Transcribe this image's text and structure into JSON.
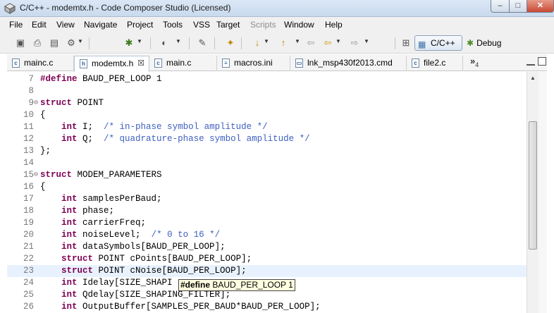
{
  "window": {
    "title": "C/C++ - modemtx.h - Code Composer Studio (Licensed)",
    "controls": {
      "minimize": "–",
      "maximize": "□",
      "close": "✕"
    }
  },
  "menu": [
    {
      "label": "File"
    },
    {
      "label": "Edit"
    },
    {
      "label": "View"
    },
    {
      "label": "Navigate"
    },
    {
      "label": "Project"
    },
    {
      "label": "Tools"
    },
    {
      "label": "VSS"
    },
    {
      "label": "Target"
    },
    {
      "label": "Scripts",
      "disabled": true
    },
    {
      "label": "Window"
    },
    {
      "label": "Help"
    }
  ],
  "toolbar": {
    "perspectives": [
      {
        "label": "C/C++",
        "icon": "c-cpp-perspective-icon",
        "active": true
      },
      {
        "label": "Debug",
        "icon": "debug-bug-icon",
        "active": false
      }
    ]
  },
  "tabs": [
    {
      "label": "mainc.c",
      "icon": "c"
    },
    {
      "label": "modemtx.h",
      "icon": "h",
      "active": true
    },
    {
      "label": "main.c",
      "icon": "c"
    },
    {
      "label": "macros.ini",
      "icon": "ini"
    },
    {
      "label": "lnk_msp430f2013.cmd",
      "icon": "cmd"
    },
    {
      "label": "file2.c",
      "icon": "c"
    }
  ],
  "tab_overflow": {
    "label": "»",
    "count": "4"
  },
  "editor": {
    "lines": [
      {
        "n": "7",
        "fold": "",
        "code": [
          [
            "pp",
            "#define"
          ],
          [
            "t",
            " BAUD_PER_LOOP 1"
          ]
        ]
      },
      {
        "n": "8",
        "fold": "",
        "code": []
      },
      {
        "n": "9",
        "fold": "⊖",
        "code": [
          [
            "kw",
            "struct"
          ],
          [
            "t",
            " POINT"
          ]
        ]
      },
      {
        "n": "10",
        "fold": "",
        "code": [
          [
            "t",
            "{"
          ]
        ]
      },
      {
        "n": "11",
        "fold": "",
        "code": [
          [
            "t",
            "    "
          ],
          [
            "kw",
            "int"
          ],
          [
            "t",
            " I;  "
          ],
          [
            "cm",
            "/* in-phase symbol amplitude */"
          ]
        ]
      },
      {
        "n": "12",
        "fold": "",
        "code": [
          [
            "t",
            "    "
          ],
          [
            "kw",
            "int"
          ],
          [
            "t",
            " Q;  "
          ],
          [
            "cm",
            "/* quadrature-phase symbol amplitude */"
          ]
        ]
      },
      {
        "n": "13",
        "fold": "",
        "code": [
          [
            "t",
            "};"
          ]
        ]
      },
      {
        "n": "14",
        "fold": "",
        "code": []
      },
      {
        "n": "15",
        "fold": "⊖",
        "code": [
          [
            "kw",
            "struct"
          ],
          [
            "t",
            " MODEM_PARAMETERS"
          ]
        ]
      },
      {
        "n": "16",
        "fold": "",
        "code": [
          [
            "t",
            "{"
          ]
        ]
      },
      {
        "n": "17",
        "fold": "",
        "code": [
          [
            "t",
            "    "
          ],
          [
            "kw",
            "int"
          ],
          [
            "t",
            " samplesPerBaud;"
          ]
        ]
      },
      {
        "n": "18",
        "fold": "",
        "code": [
          [
            "t",
            "    "
          ],
          [
            "kw",
            "int"
          ],
          [
            "t",
            " phase;"
          ]
        ]
      },
      {
        "n": "19",
        "fold": "",
        "code": [
          [
            "t",
            "    "
          ],
          [
            "kw",
            "int"
          ],
          [
            "t",
            " carrierFreq;"
          ]
        ]
      },
      {
        "n": "20",
        "fold": "",
        "code": [
          [
            "t",
            "    "
          ],
          [
            "kw",
            "int"
          ],
          [
            "t",
            " noiseLevel;  "
          ],
          [
            "cm",
            "/* 0 to 16 */"
          ]
        ]
      },
      {
        "n": "21",
        "fold": "",
        "code": [
          [
            "t",
            "    "
          ],
          [
            "kw",
            "int"
          ],
          [
            "t",
            " dataSymbols[BAUD_PER_LOOP];"
          ]
        ]
      },
      {
        "n": "22",
        "fold": "",
        "code": [
          [
            "t",
            "    "
          ],
          [
            "kw",
            "struct"
          ],
          [
            "t",
            " POINT cPoints[BAUD_PER_LOOP];"
          ]
        ]
      },
      {
        "n": "23",
        "fold": "",
        "current": true,
        "code": [
          [
            "t",
            "    "
          ],
          [
            "kw",
            "struct"
          ],
          [
            "t",
            " POINT cNoise[BAUD_PER_LOOP];"
          ]
        ]
      },
      {
        "n": "24",
        "fold": "",
        "code": [
          [
            "t",
            "    "
          ],
          [
            "kw",
            "int"
          ],
          [
            "t",
            " Idelay[SIZE_SHAPI"
          ]
        ]
      },
      {
        "n": "25",
        "fold": "",
        "code": [
          [
            "t",
            "    "
          ],
          [
            "kw",
            "int"
          ],
          [
            "t",
            " Qdelay[SIZE_SHAPING_FILTER];"
          ]
        ]
      },
      {
        "n": "26",
        "fold": "",
        "code": [
          [
            "t",
            "    "
          ],
          [
            "kw",
            "int"
          ],
          [
            "t",
            " OutputBuffer[SAMPLES_PER_BAUD*BAUD_PER_LOOP];"
          ]
        ]
      }
    ],
    "hover": {
      "keyword": "#define",
      "text": " BAUD_PER_LOOP 1"
    }
  }
}
